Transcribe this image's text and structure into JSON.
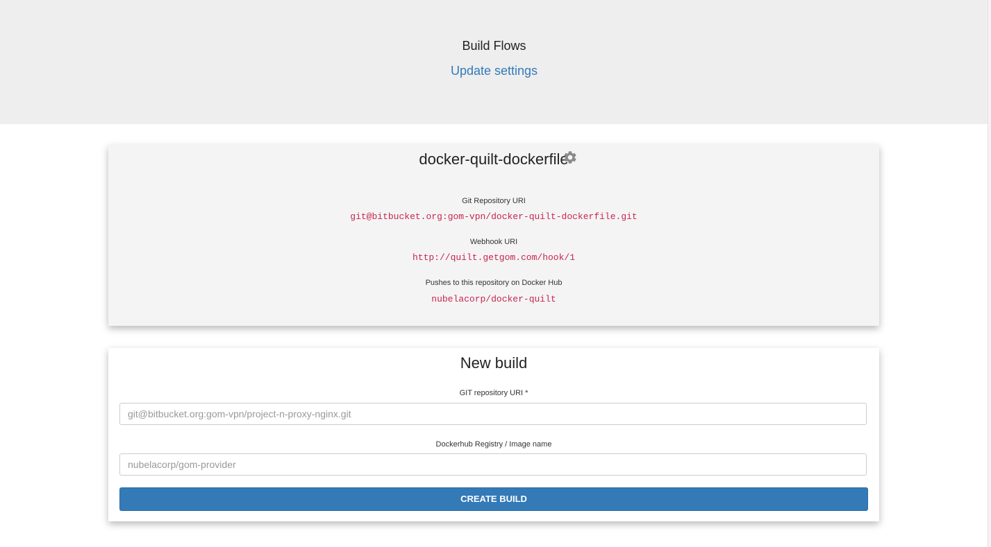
{
  "header": {
    "title": "Build Flows",
    "update_link": "Update settings"
  },
  "flow": {
    "name": "docker-quilt-dockerfile",
    "settings_icon": "gear-icon",
    "git_label": "Git Repository URI",
    "git_value": "git@bitbucket.org:gom-vpn/docker-quilt-dockerfile.git",
    "webhook_label": "Webhook URI",
    "webhook_value": "http://quilt.getgom.com/hook/1",
    "docker_label": "Pushes to this repository on Docker Hub",
    "docker_value": "nubelacorp/docker-quilt"
  },
  "new_build": {
    "title": "New build",
    "git_label": "GIT repository URI *",
    "git_placeholder": "git@bitbucket.org:gom-vpn/project-n-proxy-nginx.git",
    "image_label": "Dockerhub Registry / Image name",
    "image_placeholder": "nubelacorp/gom-provider",
    "button_label": "CREATE BUILD"
  },
  "colors": {
    "header_bg": "#eeeeee",
    "link": "#337ab7",
    "code": "#c7254e",
    "primary_button": "#337ab7"
  }
}
